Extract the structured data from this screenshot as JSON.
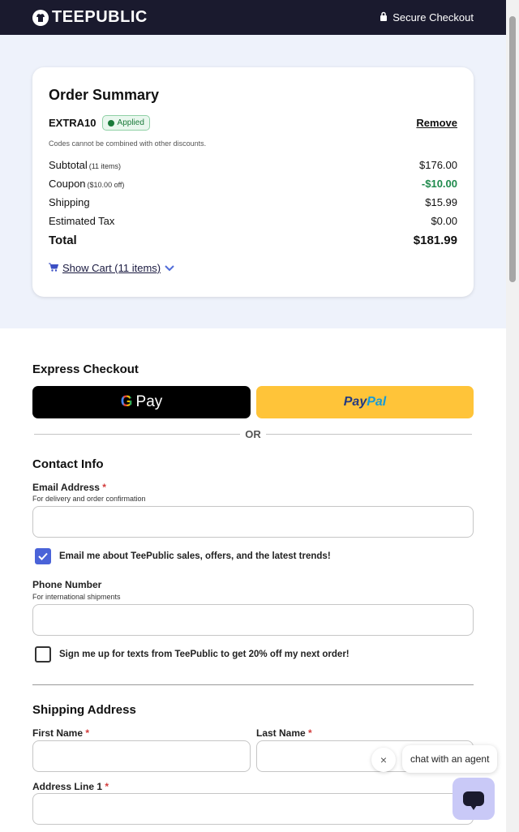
{
  "header": {
    "brand": "TEEPUBLIC",
    "secure_label": "Secure Checkout",
    "bg_color": "#1a1a2e"
  },
  "order_summary": {
    "title": "Order Summary",
    "promo_code": "EXTRA10",
    "promo_status": "Applied",
    "remove_label": "Remove",
    "promo_note": "Codes cannot be combined with other discounts.",
    "lines": [
      {
        "label": "Subtotal",
        "note": "(11 items)",
        "value": "$176.00"
      },
      {
        "label": "Coupon",
        "note": "($10.00 off)",
        "value": "-$10.00"
      },
      {
        "label": "Shipping",
        "note": "",
        "value": "$15.99"
      },
      {
        "label": "Estimated Tax",
        "note": "",
        "value": "$0.00"
      },
      {
        "label": "Total",
        "note": "",
        "value": "$181.99"
      }
    ],
    "show_cart_label": "Show Cart (11 items)",
    "icons": {
      "cart": "cart-icon",
      "chevron": "chevron-down-icon"
    }
  },
  "express": {
    "title": "Express Checkout",
    "gpay_g": "G",
    "gpay_label": "Pay",
    "paypal_1": "Pay",
    "paypal_2": "Pal",
    "or_label": "OR",
    "paypal_color": "#ffc439"
  },
  "contact": {
    "title": "Contact Info",
    "email_label": "Email Address",
    "email_help": "For delivery and order confirmation",
    "email_value": "",
    "email_opt_in": "Email me about TeePublic sales, offers, and the latest trends!",
    "email_opt_in_checked": true,
    "phone_label": "Phone Number",
    "phone_help": "For international shipments",
    "phone_value": "",
    "sms_opt_in": "Sign me up for texts from TeePublic to get 20% off my next order!",
    "sms_opt_in_checked": false
  },
  "shipping": {
    "title": "Shipping Address",
    "first_name_label": "First Name",
    "last_name_label": "Last Name",
    "address1_label": "Address Line 1",
    "required_mark": "*"
  },
  "chat": {
    "prompt": "chat with an agent",
    "close_glyph": "×"
  },
  "accent_color": "#4a63d8"
}
